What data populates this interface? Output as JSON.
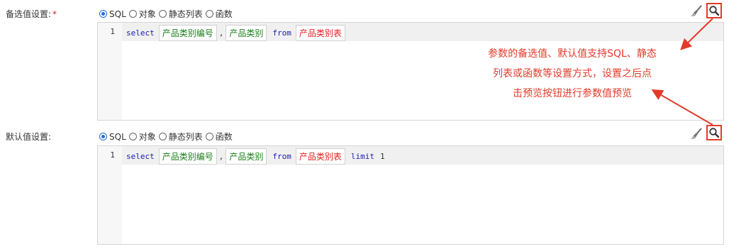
{
  "optional_values": {
    "label": "备选值设置:",
    "required_mark": "*",
    "radio_options": [
      {
        "label": "SQL",
        "selected": true
      },
      {
        "label": "对象",
        "selected": false
      },
      {
        "label": "静态列表",
        "selected": false
      },
      {
        "label": "函数",
        "selected": false
      }
    ],
    "editor": {
      "line_number": "1",
      "keyword_select": "select",
      "field1": "产品类别编号",
      "comma": ",",
      "field2": "产品类别",
      "keyword_from": "from",
      "table": "产品类别表"
    }
  },
  "default_values": {
    "label": "默认值设置:",
    "radio_options": [
      {
        "label": "SQL",
        "selected": true
      },
      {
        "label": "对象",
        "selected": false
      },
      {
        "label": "静态列表",
        "selected": false
      },
      {
        "label": "函数",
        "selected": false
      }
    ],
    "editor": {
      "line_number": "1",
      "keyword_select": "select",
      "field1": "产品类别编号",
      "comma": ",",
      "field2": "产品类别",
      "keyword_from": "from",
      "table": "产品类别表",
      "keyword_limit": "limit",
      "limit_value": "1"
    }
  },
  "annotation": {
    "lines": [
      "参数的备选值、默认值支持SQL、静态",
      "列表或函数等设置方式，设置之后点",
      "击预览按钮进行参数值预览"
    ]
  },
  "icons": {
    "clear": "brush-icon",
    "preview": "magnifier-icon"
  },
  "colors": {
    "accent": "#1e6fd9",
    "annotation_red": "#e23b2b",
    "keyword_blue": "#1b1bb0",
    "field_green": "#1a7f1a",
    "table_red": "#e02020"
  }
}
